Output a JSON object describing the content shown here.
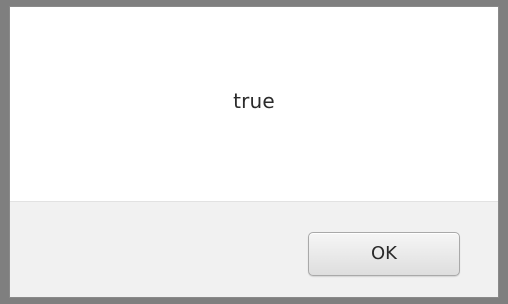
{
  "dialog": {
    "message": "true",
    "ok_label": "OK"
  }
}
